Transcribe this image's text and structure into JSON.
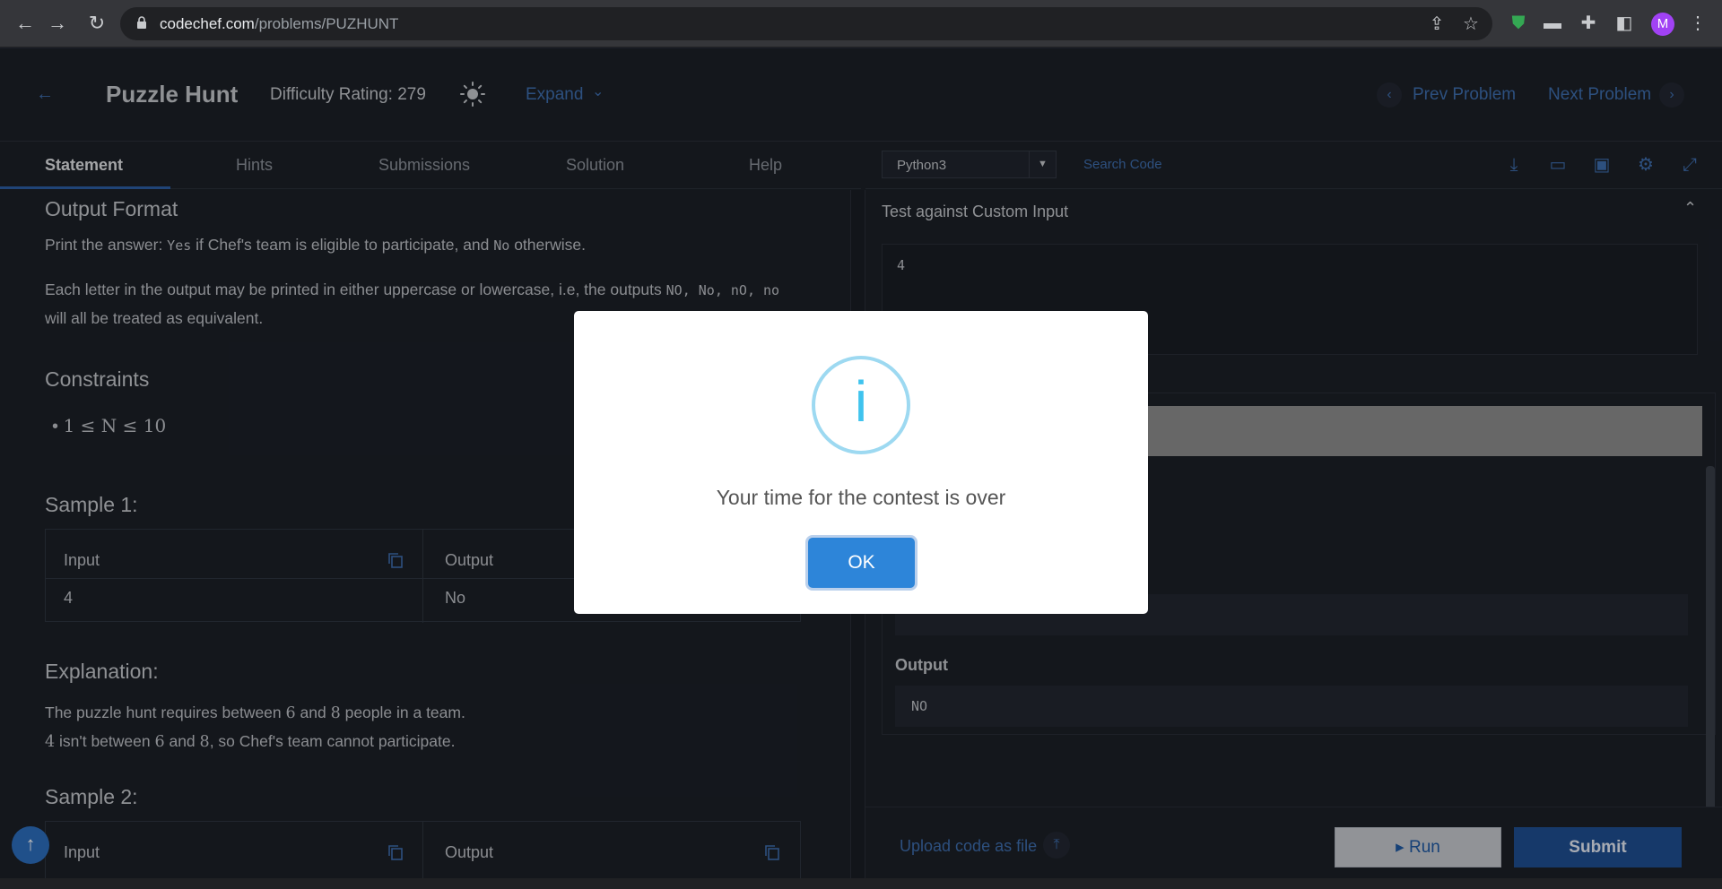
{
  "browser": {
    "url_host": "codechef.com",
    "url_path": "/problems/PUZHUNT",
    "avatar_letter": "M",
    "ext_badge": "1"
  },
  "header": {
    "title": "Puzzle Hunt",
    "difficulty": "Difficulty Rating: 279",
    "expand_label": "Expand",
    "prev_label": "Prev Problem",
    "next_label": "Next Problem"
  },
  "tabs": [
    {
      "label": "Statement",
      "active": true
    },
    {
      "label": "Hints"
    },
    {
      "label": "Submissions"
    },
    {
      "label": "Solution"
    },
    {
      "label": "Help"
    }
  ],
  "editor_toolbar": {
    "language": "Python3",
    "search_placeholder": "Search Code"
  },
  "statement": {
    "output_format_heading": "Output Format",
    "output_line_1_a": "Print the answer: ",
    "output_line_1_code1": "Yes",
    "output_line_1_b": " if Chef's team is eligible to participate, and ",
    "output_line_1_code2": "No",
    "output_line_1_c": " otherwise.",
    "output_line_2_a": "Each letter in the output may be printed in either uppercase or lowercase, i.e, the outputs ",
    "output_line_2_codes": "NO, No, nO, no",
    "output_line_3": "will all be treated as equivalent.",
    "constraints_heading": "Constraints",
    "constraint_1": "1 ≤ N ≤ 10",
    "sample1_heading": "Sample 1:",
    "sample1_input_header": "Input",
    "sample1_output_header": "Output",
    "sample1_input": "4",
    "sample1_output": "No",
    "explanation_heading": "Explanation:",
    "explanation_1a": "The puzzle hunt requires between ",
    "explanation_1_n6": "6",
    "explanation_1b": " and ",
    "explanation_1_n8": "8",
    "explanation_1c": " people in a team.",
    "explanation_2_n4": "4",
    "explanation_2a": " isn't between ",
    "explanation_2_n6": "6",
    "explanation_2b": " and ",
    "explanation_2_n8": "8",
    "explanation_2c": ", so Chef's team cannot participate.",
    "sample2_heading": "Sample 2:",
    "sample2_input_header": "Input",
    "sample2_output_header": "Output"
  },
  "right_panel": {
    "custom_input_title": "Test against Custom Input",
    "custom_input_value": "4",
    "output_label": "Output",
    "output_value": "NO",
    "upload_label": "Upload code as file",
    "run_label": "Run",
    "submit_label": "Submit"
  },
  "modal": {
    "icon": "i",
    "message": "Your time for the contest is over",
    "ok_label": "OK"
  },
  "colors": {
    "accent_blue": "#3f6fb0",
    "submit_blue": "#1f4f93",
    "modal_ok": "#2d85d9",
    "info_icon": "#3fc3ee"
  }
}
